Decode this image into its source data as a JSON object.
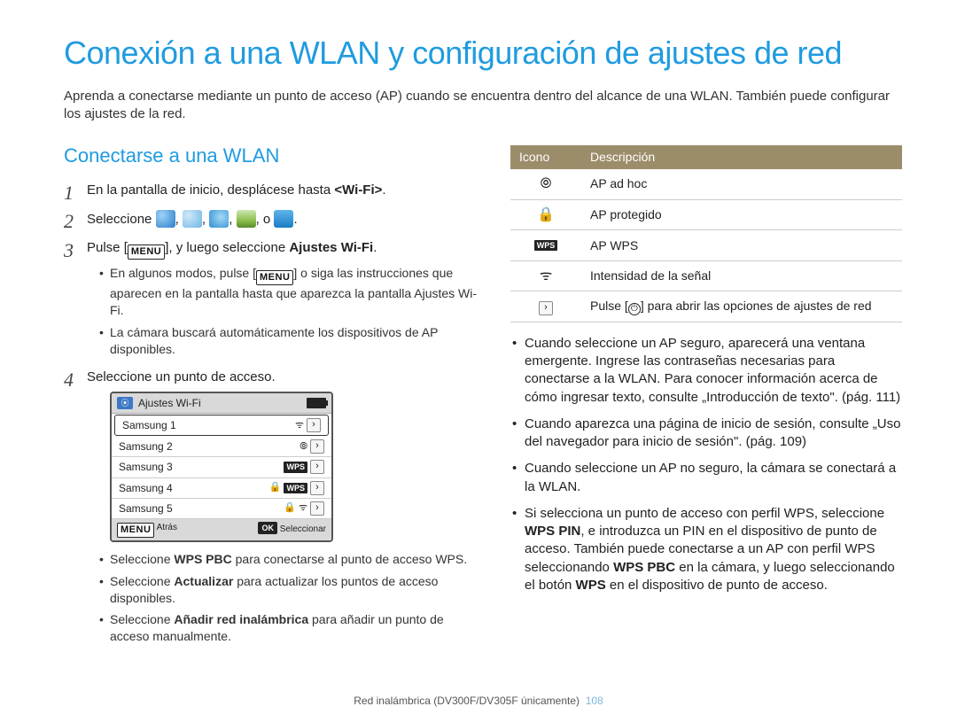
{
  "title": "Conexión a una WLAN y configuración de ajustes de red",
  "intro": "Aprenda a conectarse mediante un punto de acceso (AP) cuando se encuentra dentro del alcance de una WLAN. También puede configurar los ajustes de la red.",
  "section_heading": "Conectarse a una WLAN",
  "step1": {
    "text_pre": "En la pantalla de inicio, desplácese hasta ",
    "bold": "<Wi-Fi>",
    "after": "."
  },
  "step2": {
    "text": "Seleccione ",
    "sep1": ", ",
    "sep_or": ", o ",
    "after": "."
  },
  "step3": {
    "text_pre": "Pulse [",
    "menu": "MENU",
    "text_mid": "], y luego seleccione ",
    "bold": "Ajustes Wi-Fi",
    "after": ".",
    "sub1_pre": "En algunos modos, pulse [",
    "sub1_menu": "MENU",
    "sub1_post": "] o siga las instrucciones que aparecen en la pantalla hasta que aparezca la pantalla Ajustes Wi-Fi.",
    "sub2": "La cámara buscará automáticamente los dispositivos de AP disponibles."
  },
  "step4": {
    "text": "Seleccione un punto de acceso.",
    "sub1_pre": "Seleccione ",
    "sub1_bold": "WPS PBC",
    "sub1_post": " para conectarse al punto de acceso WPS.",
    "sub2_pre": "Seleccione ",
    "sub2_bold": "Actualizar",
    "sub2_post": " para actualizar los puntos de acceso disponibles.",
    "sub3_pre": "Seleccione ",
    "sub3_bold": "Añadir red inalámbrica",
    "sub3_post": " para añadir un punto de acceso manualmente."
  },
  "device": {
    "title": "Ajustes Wi-Fi",
    "rows": [
      "Samsung 1",
      "Samsung 2",
      "Samsung 3",
      "Samsung 4",
      "Samsung 5"
    ],
    "back_label": "Atrás",
    "back_badge": "MENU",
    "ok_badge": "OK",
    "select_label": "Seleccionar"
  },
  "legend": {
    "h1": "Icono",
    "h2": "Descripción",
    "r1": "AP ad hoc",
    "r2": "AP protegido",
    "r3": "AP WPS",
    "r4": "Intensidad de la señal",
    "r5_pre": "Pulse [",
    "r5_post": "] para abrir las opciones de ajustes de red"
  },
  "right": {
    "b1": "Cuando seleccione un AP seguro, aparecerá una ventana emergente. Ingrese las contraseñas necesarias para conectarse a la WLAN. Para conocer información acerca de cómo ingresar texto, consulte „Introducción de texto\". (pág. 111)",
    "b2": "Cuando aparezca una página de inicio de sesión, consulte „Uso del navegador para inicio de sesión\". (pág. 109)",
    "b3": "Cuando seleccione un AP no seguro, la cámara se conectará a la WLAN.",
    "b4_pre": "Si selecciona un punto de acceso con perfil WPS, seleccione ",
    "b4_bold1": "WPS PIN",
    "b4_mid": ", e introduzca un PIN en el dispositivo de punto de acceso. También puede conectarse a un AP con perfil WPS seleccionando ",
    "b4_bold2": "WPS PBC",
    "b4_mid2": " en la cámara, y luego seleccionando el botón ",
    "b4_bold3": "WPS",
    "b4_post": " en el dispositivo de punto de acceso."
  },
  "footer": {
    "text": "Red inalámbrica (DV300F/DV305F únicamente)",
    "page": "108"
  }
}
